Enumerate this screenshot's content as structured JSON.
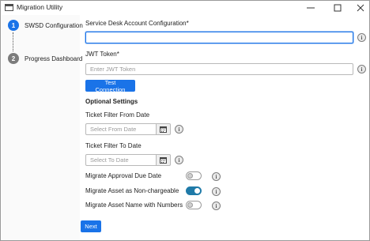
{
  "window": {
    "title": "Migration Utility"
  },
  "sidebar": {
    "steps": [
      {
        "number": "1",
        "label": "SWSD Configuration"
      },
      {
        "number": "2",
        "label": "Progress Dashboard"
      }
    ]
  },
  "form": {
    "account_label": "Service Desk Account Configuration*",
    "account_value": "",
    "jwt_label": "JWT Token*",
    "jwt_placeholder": "Enter JWT Token",
    "test_button": "Test Connection",
    "optional_heading": "Optional Settings",
    "from_label": "Ticket Filter From Date",
    "from_placeholder": "Select From Date",
    "to_label": "Ticket Filter To Date",
    "to_placeholder": "Select To Date",
    "toggles": [
      {
        "label": "Migrate Approval Due Date",
        "on": false
      },
      {
        "label": "Migrate Asset as Non-chargeable",
        "on": true
      },
      {
        "label": "Migrate Asset Name with Numbers",
        "on": false
      }
    ],
    "info_glyph": "i",
    "next_button": "Next"
  },
  "colors": {
    "accent": "#1a73e8",
    "toggle_on": "#1f7aa8"
  },
  "icons": [
    "app-window-icon",
    "minimize-icon",
    "maximize-icon",
    "close-icon",
    "calendar-icon",
    "info-icon"
  ]
}
